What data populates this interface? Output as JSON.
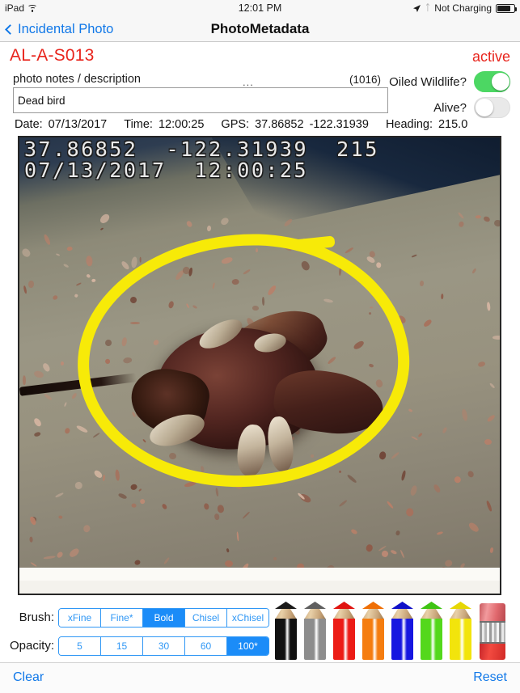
{
  "status_bar": {
    "device": "iPad",
    "wifi_icon": "wifi-icon",
    "time": "12:01 PM",
    "location_icon": "location-arrow-icon",
    "bluetooth_icon": "bluetooth-icon",
    "charging_text": "Not Charging",
    "battery_icon": "battery-icon"
  },
  "nav": {
    "back_label": "Incidental Photo",
    "back_icon": "chevron-left-icon",
    "title": "PhotoMetadata"
  },
  "record": {
    "id": "AL-A-S013",
    "status": "active",
    "accent_color": "#e8241c"
  },
  "notes": {
    "label": "photo notes / description",
    "ellipsis": "...",
    "char_count": "(1016)",
    "value": "Dead bird",
    "placeholder": "photo notes / description"
  },
  "toggles": [
    {
      "label": "Oiled Wildlife?",
      "state": "on"
    },
    {
      "label": "Alive?",
      "state": "off"
    }
  ],
  "metadata": {
    "date_label": "Date:",
    "date_value": "07/13/2017",
    "time_label": "Time:",
    "time_value": "12:00:25",
    "gps_label": "GPS:",
    "gps_lat": "37.86852",
    "gps_lon": "-122.31939",
    "heading_label": "Heading:",
    "heading_value": "215.0"
  },
  "photo": {
    "stamp_line1": "37.86852  -122.31939  215",
    "stamp_line2": "07/13/2017  12:00:25",
    "annotation_color": "#f7ea08",
    "alt": "dead oiled bird on beach"
  },
  "toolbar": {
    "brush_label": "Brush:",
    "brush_options": [
      {
        "label": "xFine",
        "selected": false
      },
      {
        "label": "Fine*",
        "selected": false
      },
      {
        "label": "Bold",
        "selected": true
      },
      {
        "label": "Chisel",
        "selected": false
      },
      {
        "label": "xChisel",
        "selected": false
      }
    ],
    "opacity_label": "Opacity:",
    "opacity_options": [
      {
        "label": "5",
        "selected": false
      },
      {
        "label": "15",
        "selected": false
      },
      {
        "label": "30",
        "selected": false
      },
      {
        "label": "60",
        "selected": false
      },
      {
        "label": "100*",
        "selected": true
      }
    ],
    "selected_color": "#1b8cf8",
    "pencils": [
      {
        "name": "black",
        "color": "#111111",
        "tip": "#1a1a1a"
      },
      {
        "name": "gray",
        "color": "#8d8d8d",
        "tip": "#5f5f5f"
      },
      {
        "name": "red",
        "color": "#ec1c16",
        "tip": "#e01410"
      },
      {
        "name": "orange",
        "color": "#f57d10",
        "tip": "#ef6f06"
      },
      {
        "name": "blue",
        "color": "#1616e0",
        "tip": "#1111c8"
      },
      {
        "name": "green",
        "color": "#54d81c",
        "tip": "#3fc413"
      },
      {
        "name": "yellow",
        "color": "#f2e40c",
        "tip": "#e6d705"
      }
    ],
    "eraser": "eraser"
  },
  "bottom_bar": {
    "clear_label": "Clear",
    "reset_label": "Reset"
  }
}
